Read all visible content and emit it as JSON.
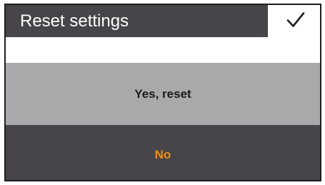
{
  "dialog": {
    "title": "Reset settings",
    "confirm_icon": "checkmark-icon"
  },
  "options": {
    "yes_label": "Yes, reset",
    "no_label": "No"
  },
  "colors": {
    "header_background": "#48454a",
    "option_yes_background": "#a9a8ab",
    "option_no_background": "#48454a",
    "option_no_text": "#e8900f"
  }
}
